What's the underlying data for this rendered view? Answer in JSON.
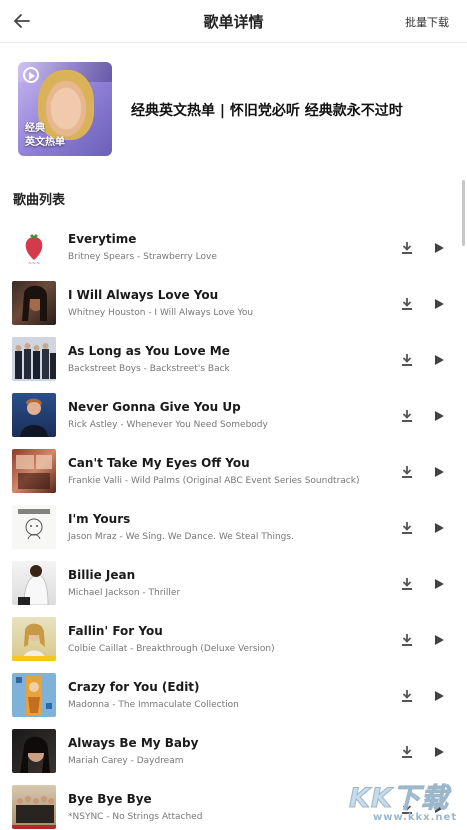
{
  "header": {
    "title": "歌单详情",
    "batch_download": "批量下载"
  },
  "playlist": {
    "cover_label_line1": "经典",
    "cover_label_line2": "英文热单",
    "title": "经典英文热单 | 怀旧党必听 经典款永不过时"
  },
  "section_title": "歌曲列表",
  "songs": [
    {
      "name": "Everytime",
      "meta": "Britney Spears - Strawberry Love"
    },
    {
      "name": "I Will Always Love You",
      "meta": "Whitney Houston - I Will Always Love You"
    },
    {
      "name": "As Long as You Love Me",
      "meta": "Backstreet Boys - Backstreet's Back"
    },
    {
      "name": "Never Gonna Give You Up",
      "meta": "Rick Astley - Whenever You Need Somebody"
    },
    {
      "name": "Can't Take My Eyes Off You",
      "meta": "Frankie Valli - Wild Palms (Original ABC Event Series Soundtrack)"
    },
    {
      "name": "I'm Yours",
      "meta": "Jason Mraz - We Sing. We Dance. We Steal Things."
    },
    {
      "name": "Billie Jean",
      "meta": "Michael Jackson - Thriller"
    },
    {
      "name": "Fallin' For You",
      "meta": "Colbie Caillat - Breakthrough (Deluxe Version)"
    },
    {
      "name": "Crazy for You (Edit)",
      "meta": "Madonna - The Immaculate Collection"
    },
    {
      "name": "Always Be My Baby",
      "meta": "Mariah Carey - Daydream"
    },
    {
      "name": "Bye Bye Bye",
      "meta": "*NSYNC - No Strings Attached"
    }
  ],
  "watermark": {
    "big": "KK下载",
    "small": "www.kkx.net"
  },
  "icons": {
    "back": "arrow-left-icon",
    "download": "download-icon",
    "play": "play-icon"
  }
}
